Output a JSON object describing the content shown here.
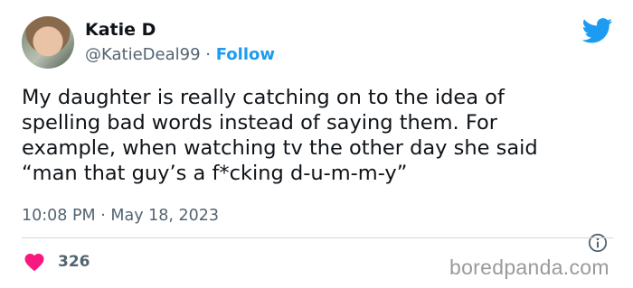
{
  "author": {
    "name": "Katie D",
    "handle": "@KatieDeal99",
    "separator": "·",
    "follow_label": "Follow"
  },
  "tweet": {
    "lines": [
      "My daughter is really catching on to the idea of",
      "spelling bad words instead of saying them. For",
      "example, when watching tv the other day she said",
      "“man that guy’s a f*cking d-u-m-m-y”"
    ],
    "time": "10:08 PM",
    "meta_separator": "·",
    "date": "May 18, 2023",
    "likes": "326"
  },
  "icons": {
    "brand": "twitter-bird-icon",
    "info": "info-icon",
    "like": "heart-icon"
  },
  "colors": {
    "accent": "#1d9bf0",
    "heart": "#f91880",
    "muted": "#536471"
  },
  "watermark": "boredpanda.com"
}
